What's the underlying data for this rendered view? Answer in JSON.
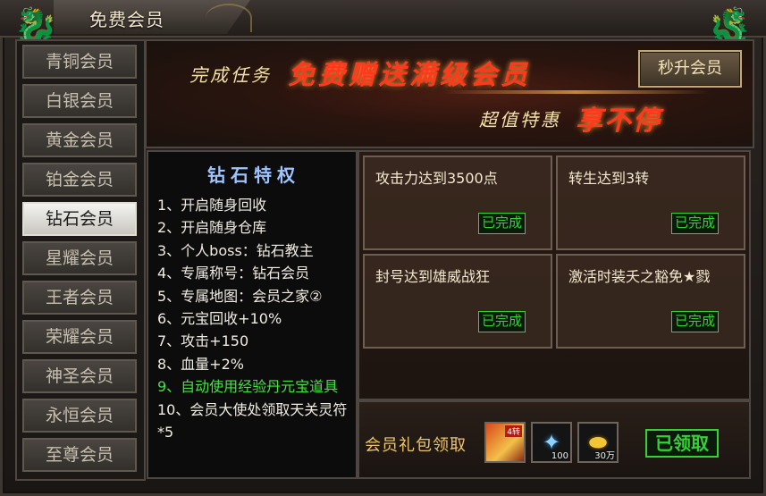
{
  "window": {
    "title": "免费会员"
  },
  "sidebar": {
    "items": [
      {
        "label": "青铜会员",
        "active": false
      },
      {
        "label": "白银会员",
        "active": false
      },
      {
        "label": "黄金会员",
        "active": false
      },
      {
        "label": "铂金会员",
        "active": false
      },
      {
        "label": "钻石会员",
        "active": true
      },
      {
        "label": "星耀会员",
        "active": false
      },
      {
        "label": "王者会员",
        "active": false
      },
      {
        "label": "荣耀会员",
        "active": false
      },
      {
        "label": "神圣会员",
        "active": false
      },
      {
        "label": "永恒会员",
        "active": false
      },
      {
        "label": "至尊会员",
        "active": false
      }
    ]
  },
  "banner": {
    "line1_pre": "完成任务",
    "line1_big": "免费赠送满级会员",
    "line2_pre": "超值特惠",
    "line2_big": "享不停",
    "upgrade_button": "秒升会员"
  },
  "privileges": {
    "title": "钻石特权",
    "items": [
      "1、开启随身回收",
      "2、开启随身仓库",
      "3、个人boss：钻石教主",
      "4、专属称号：钻石会员",
      "5、专属地图：会员之家②",
      "6、元宝回收+10%",
      "7、攻击+150",
      "8、血量+2%",
      "9、自动使用经验丹元宝道具",
      "10、会员大使处领取天关灵符*5"
    ],
    "highlight_color": "#42e342"
  },
  "tasks": [
    {
      "label": "攻击力达到3500点",
      "status": "已完成"
    },
    {
      "label": "转生达到3转",
      "status": "已完成"
    },
    {
      "label": "封号达到雄威战狂",
      "status": "已完成"
    },
    {
      "label": "激活时装夭之豁免★戮",
      "status": "已完成"
    }
  ],
  "gift": {
    "label": "会员礼包领取",
    "items": [
      {
        "icon": "book-icon",
        "qty": "",
        "tag": "4转"
      },
      {
        "icon": "crystal-icon",
        "qty": "100"
      },
      {
        "icon": "gold-ingot-icon",
        "qty": "30万"
      }
    ],
    "claim_status": "已领取"
  }
}
